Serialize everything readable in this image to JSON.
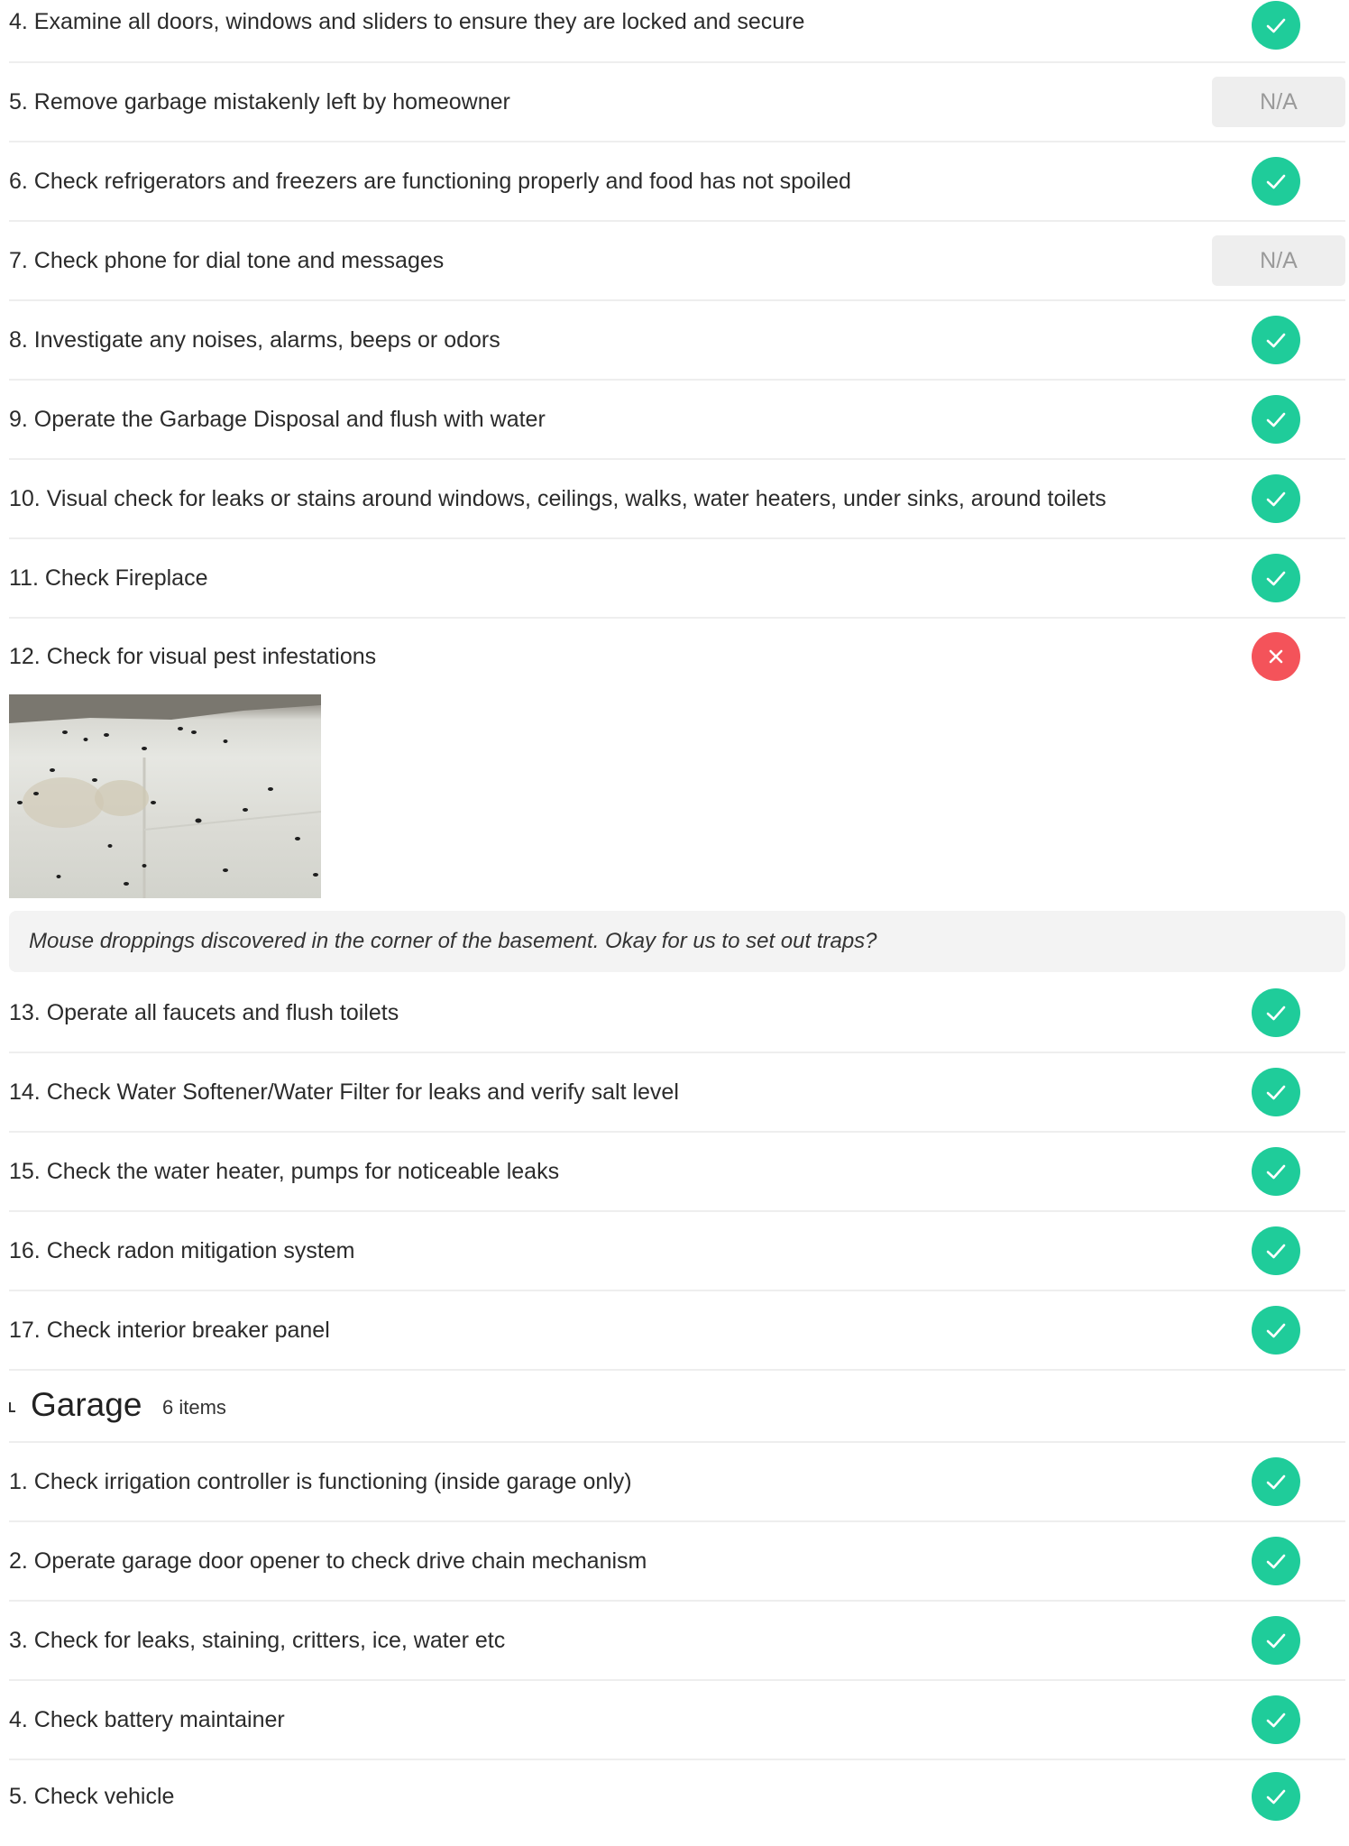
{
  "colors": {
    "pass": "#1fcc9a",
    "fail": "#f4535a",
    "na_bg": "#eeeeee",
    "note_bg": "#f3f3f3"
  },
  "icons": {
    "pass": "check-icon",
    "fail": "x-icon"
  },
  "interior": {
    "items": [
      {
        "label": "4. Examine all doors, windows and sliders to ensure they are locked and secure",
        "status": "pass"
      },
      {
        "label": "5. Remove garbage mistakenly left by homeowner",
        "status": "na",
        "status_text": "N/A"
      },
      {
        "label": "6. Check refrigerators and freezers are functioning properly and food has not spoiled",
        "status": "pass"
      },
      {
        "label": "7. Check phone for dial tone and messages",
        "status": "na",
        "status_text": "N/A"
      },
      {
        "label": "8. Investigate any noises, alarms, beeps or odors",
        "status": "pass"
      },
      {
        "label": "9. Operate the Garbage Disposal and flush with water",
        "status": "pass"
      },
      {
        "label": "10. Visual check for leaks or stains around windows, ceilings, walks, water heaters, under sinks, around toilets",
        "status": "pass"
      },
      {
        "label": "11. Check Fireplace",
        "status": "pass"
      },
      {
        "label": "12. Check for visual pest infestations",
        "status": "fail"
      },
      {
        "label": "13. Operate all faucets and flush toilets",
        "status": "pass"
      },
      {
        "label": "14. Check Water Softener/Water Filter for leaks and verify salt level",
        "status": "pass"
      },
      {
        "label": "15. Check the water heater, pumps for noticeable leaks",
        "status": "pass"
      },
      {
        "label": "16. Check radon mitigation system",
        "status": "pass"
      },
      {
        "label": "17. Check  interior breaker panel",
        "status": "pass"
      }
    ],
    "pest_note": "Mouse droppings discovered in the corner of the basement.  Okay for us to set out traps?"
  },
  "garage": {
    "title": "Garage",
    "count": "6 items",
    "items": [
      {
        "label": "1. Check irrigation controller is functioning (inside garage only)",
        "status": "pass"
      },
      {
        "label": "2. Operate garage door opener to check drive chain mechanism",
        "status": "pass"
      },
      {
        "label": "3. Check for leaks, staining, critters, ice, water etc",
        "status": "pass"
      },
      {
        "label": "4. Check battery maintainer",
        "status": "pass"
      },
      {
        "label": "5. Check vehicle",
        "status": "pass"
      }
    ]
  }
}
